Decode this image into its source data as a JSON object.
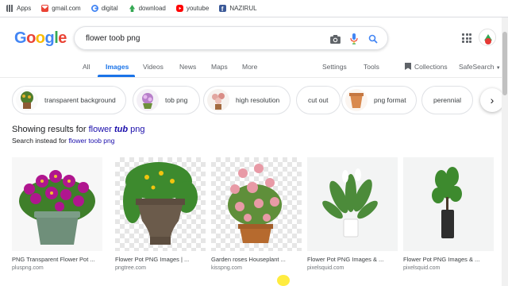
{
  "bookmarks": [
    {
      "label": "Apps",
      "icon": "apps-grid-icon"
    },
    {
      "label": "gmail.com",
      "icon": "gmail-icon"
    },
    {
      "label": "digital",
      "icon": "google-g-icon"
    },
    {
      "label": "download",
      "icon": "download-icon"
    },
    {
      "label": "youtube",
      "icon": "youtube-icon"
    },
    {
      "label": "NAZIRUL",
      "icon": "facebook-icon"
    }
  ],
  "logo": [
    "G",
    "o",
    "o",
    "g",
    "l",
    "e"
  ],
  "search": {
    "value": "flower toob png"
  },
  "tabs": {
    "all": "All",
    "images": "Images",
    "videos": "Videos",
    "news": "News",
    "maps": "Maps",
    "more": "More",
    "settings": "Settings",
    "tools": "Tools",
    "collections": "Collections",
    "safesearch": "SafeSearch"
  },
  "chips": [
    {
      "label": "transparent background"
    },
    {
      "label": "tob png"
    },
    {
      "label": "high resolution"
    },
    {
      "label": "cut out"
    },
    {
      "label": "png format"
    },
    {
      "label": "perennial"
    }
  ],
  "spelling": {
    "prefix": "Showing results for ",
    "corrected_plain": "flower ",
    "corrected_bold": "tub",
    "corrected_tail": " png",
    "instead_prefix": "Search instead for ",
    "instead_link": "flower toob png"
  },
  "results": [
    {
      "title": "PNG Transparent Flower Pot ...",
      "site": "pluspng.com"
    },
    {
      "title": "Flower Pot PNG Images | ...",
      "site": "pngtree.com"
    },
    {
      "title": "Garden roses Houseplant ...",
      "site": "kisspng.com"
    },
    {
      "title": "Flower Pot PNG Images & ...",
      "site": "pixelsquid.com"
    },
    {
      "title": "Flower Pot PNG Images & ...",
      "site": "pixelsquid.com"
    }
  ],
  "colors": {
    "accent": "#1a73e8",
    "link": "#1a0dab"
  }
}
